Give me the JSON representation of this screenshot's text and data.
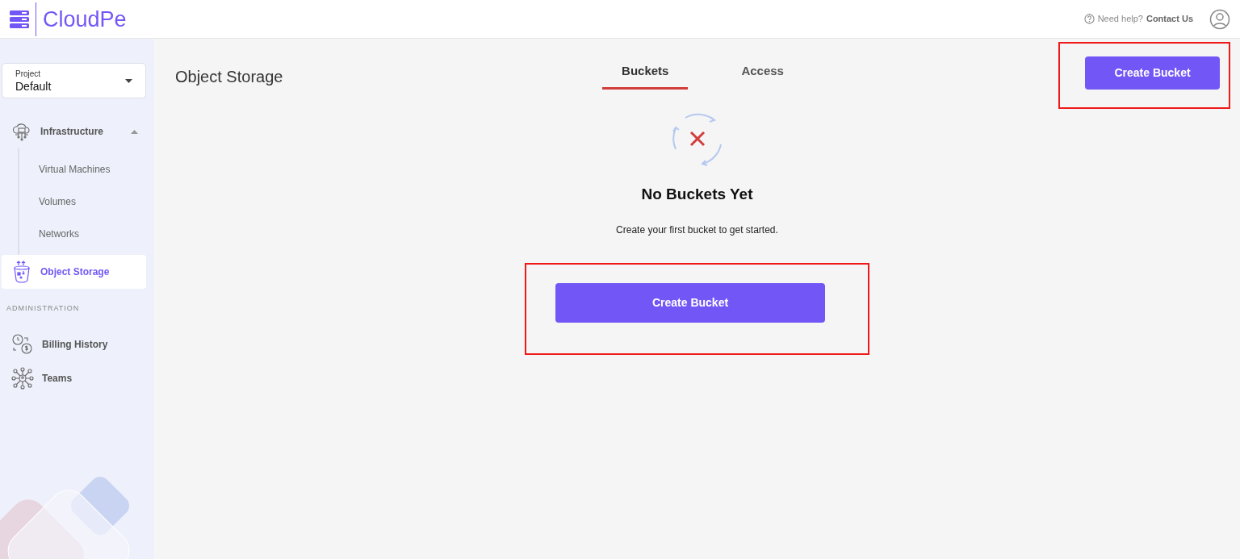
{
  "header": {
    "logo_text": "CloudPe",
    "help_text": "Need help?",
    "contact_link": "Contact Us"
  },
  "sidebar": {
    "project": {
      "label": "Project",
      "value": "Default"
    },
    "items": [
      {
        "kind": "item",
        "label": "Infrastructure",
        "selected": false,
        "expanded": true,
        "children": [
          {
            "label": "Virtual Machines"
          },
          {
            "label": "Volumes"
          },
          {
            "label": "Networks"
          }
        ]
      },
      {
        "kind": "item",
        "label": "Object Storage",
        "selected": true
      },
      {
        "kind": "heading",
        "label": "ADMINISTRATION"
      },
      {
        "kind": "item",
        "label": "Billing History",
        "selected": false
      },
      {
        "kind": "item",
        "label": "Teams",
        "selected": false
      }
    ]
  },
  "page": {
    "title": "Object Storage",
    "tabs": [
      {
        "label": "Buckets",
        "selected": true
      },
      {
        "label": "Access",
        "selected": false
      }
    ],
    "create_button": {
      "label": "Create Bucket",
      "highlighted": true
    },
    "empty_state": {
      "title": "No Buckets Yet",
      "message": "Create your first bucket to get started.",
      "button": {
        "label": "Create Bucket",
        "highlighted": true
      }
    }
  }
}
